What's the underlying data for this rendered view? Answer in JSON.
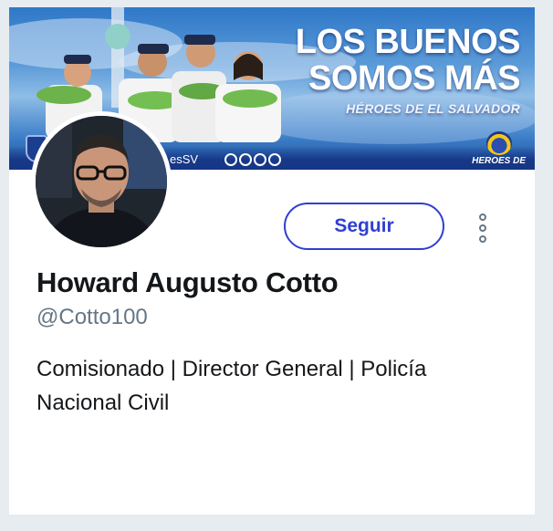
{
  "banner": {
    "headline_line1": "LOS BUENOS",
    "headline_line2": "SOMOS MÁS",
    "subheadline": "HÉROES DE EL SALVADOR",
    "handle_fragment": "esSV",
    "logo_text": "HEROES DE"
  },
  "profile": {
    "name": "Howard Augusto Cotto",
    "handle": "@Cotto100",
    "bio": "Comisionado | Director General | Policía Nacional Civil"
  },
  "actions": {
    "follow_label": "Seguir"
  },
  "colors": {
    "accent": "#2f3fd1",
    "background": "#e6ecf0",
    "card": "#ffffff",
    "secondary_text": "#657786"
  },
  "icons": {
    "more": "more-vertical-icon"
  }
}
